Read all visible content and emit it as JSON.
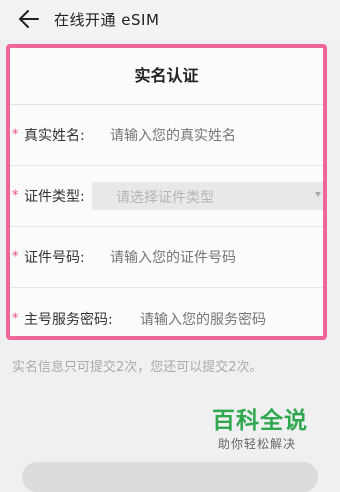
{
  "header": {
    "back_icon": "arrow-left-icon",
    "title": "在线开通 eSIM"
  },
  "form": {
    "title": "实名认证",
    "required_mark": "*",
    "fields": [
      {
        "label": "真实姓名:",
        "placeholder": "请输入您的真实姓名"
      },
      {
        "label": "证件类型:",
        "placeholder": "请选择证件类型",
        "type": "select"
      },
      {
        "label": "证件号码:",
        "placeholder": "请输入您的证件号码"
      },
      {
        "label": "主号服务密码:",
        "placeholder": "请输入您的服务密码"
      }
    ]
  },
  "notice": "实名信息只可提交2次，您还可以提交2次。",
  "watermark": {
    "main": "百科全说",
    "sub": "助你轻松解决"
  },
  "colors": {
    "highlight_border": "#f0669b",
    "required": "#e8507f",
    "watermark": "#2fa84f"
  }
}
